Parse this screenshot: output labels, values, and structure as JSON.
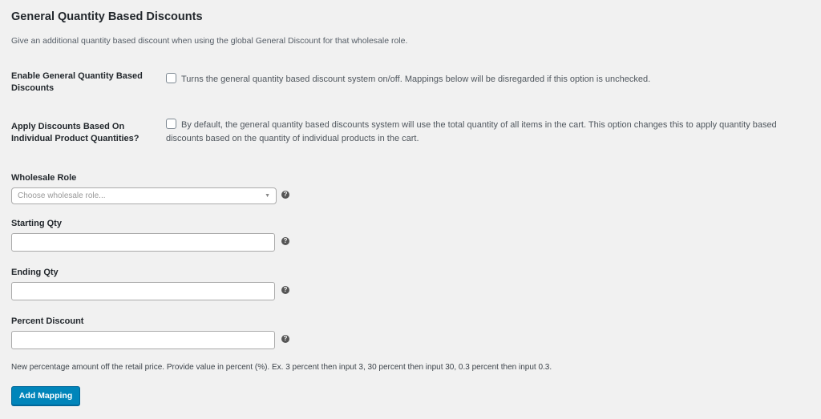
{
  "section": {
    "title": "General Quantity Based Discounts",
    "description": "Give an additional quantity based discount when using the global General Discount for that wholesale role."
  },
  "options": [
    {
      "label": "Enable General Quantity Based Discounts",
      "checked": false,
      "description": "Turns the general quantity based discount system on/off. Mappings below will be disregarded if this option is unchecked."
    },
    {
      "label": "Apply Discounts Based On Individual Product Quantities?",
      "checked": false,
      "description": "By default, the general quantity based discounts system will use the total quantity of all items in the cart. This option changes this to apply quantity based discounts based on the quantity of individual products in the cart."
    }
  ],
  "fields": {
    "wholesale_role": {
      "label": "Wholesale Role",
      "placeholder": "Choose wholesale role...",
      "value": ""
    },
    "starting_qty": {
      "label": "Starting Qty",
      "value": ""
    },
    "ending_qty": {
      "label": "Ending Qty",
      "value": ""
    },
    "percent_discount": {
      "label": "Percent Discount",
      "value": ""
    }
  },
  "help_icon": "?",
  "dropdown_icon": "▼",
  "note": "New percentage amount off the retail price. Provide value in percent (%). Ex. 3 percent then input 3, 30 percent then input 30, 0.3 percent then input 0.3.",
  "add_mapping_label": "Add Mapping",
  "colors": {
    "primary_button": "#0085ba",
    "background": "#f1f1f1"
  }
}
